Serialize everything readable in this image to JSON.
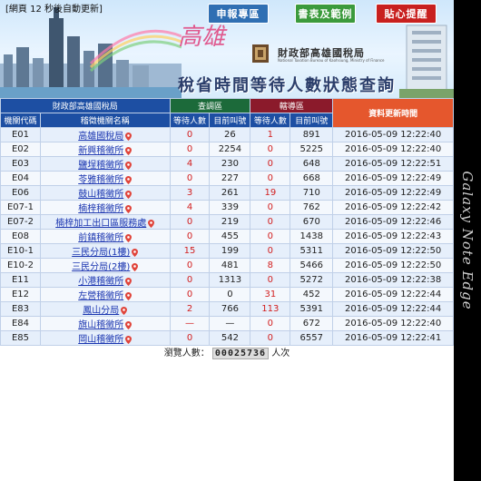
{
  "header": {
    "refresh_notice": "[網頁 12 秒後自動更新]",
    "nav": {
      "report": "申報專區",
      "forms": "書表及範例",
      "reminder": "貼心提醒"
    },
    "logo_art": "高雄",
    "bureau_name": "財政部高雄國稅局",
    "bureau_english": "National Taxation Bureau of Kaohsiung, Ministry of Finance",
    "page_title": "稅省時間等待人數狀態查詢"
  },
  "table": {
    "group_headers": {
      "left": "財政部高雄國稅局",
      "inquiry": "查調區",
      "transfer": "轄導區",
      "updated": "資料更新時間"
    },
    "columns": {
      "code": "機關代碼",
      "name": "稽徵機關名稱",
      "inquiry_waiting": "等待人數",
      "inquiry_current": "目前叫號",
      "transfer_waiting": "等待人數",
      "transfer_current": "目前叫號"
    },
    "rows": [
      {
        "code": "E01",
        "name": "高雄國稅局",
        "iw": "0",
        "ic": "26",
        "tw": "1",
        "tc": "891",
        "time": "2016-05-09 12:22:40"
      },
      {
        "code": "E02",
        "name": "新興稽徵所",
        "iw": "0",
        "ic": "2254",
        "tw": "0",
        "tc": "5225",
        "time": "2016-05-09 12:22:40"
      },
      {
        "code": "E03",
        "name": "鹽埕稽徵所",
        "iw": "4",
        "ic": "230",
        "tw": "0",
        "tc": "648",
        "time": "2016-05-09 12:22:51"
      },
      {
        "code": "E04",
        "name": "苓雅稽徵所",
        "iw": "0",
        "ic": "227",
        "tw": "0",
        "tc": "668",
        "time": "2016-05-09 12:22:49"
      },
      {
        "code": "E06",
        "name": "鼓山稽徵所",
        "iw": "3",
        "ic": "261",
        "tw": "19",
        "tc": "710",
        "time": "2016-05-09 12:22:49"
      },
      {
        "code": "E07-1",
        "name": "楠梓稽徵所",
        "iw": "4",
        "ic": "339",
        "tw": "0",
        "tc": "762",
        "time": "2016-05-09 12:22:42"
      },
      {
        "code": "E07-2",
        "name": "楠梓加工出口區服務處",
        "iw": "0",
        "ic": "219",
        "tw": "0",
        "tc": "670",
        "time": "2016-05-09 12:22:46"
      },
      {
        "code": "E08",
        "name": "前鎮稽徵所",
        "iw": "0",
        "ic": "455",
        "tw": "0",
        "tc": "1438",
        "time": "2016-05-09 12:22:43"
      },
      {
        "code": "E10-1",
        "name": "三民分局(1樓)",
        "iw": "15",
        "ic": "199",
        "tw": "0",
        "tc": "5311",
        "time": "2016-05-09 12:22:50"
      },
      {
        "code": "E10-2",
        "name": "三民分局(2樓)",
        "iw": "0",
        "ic": "481",
        "tw": "8",
        "tc": "5466",
        "time": "2016-05-09 12:22:50"
      },
      {
        "code": "E11",
        "name": "小港稽徵所",
        "iw": "0",
        "ic": "1313",
        "tw": "0",
        "tc": "5272",
        "time": "2016-05-09 12:22:38"
      },
      {
        "code": "E12",
        "name": "左營稽徵所",
        "iw": "0",
        "ic": "0",
        "tw": "31",
        "tc": "452",
        "time": "2016-05-09 12:22:44"
      },
      {
        "code": "E83",
        "name": "鳳山分局",
        "iw": "2",
        "ic": "766",
        "tw": "113",
        "tc": "5391",
        "time": "2016-05-09 12:22:44"
      },
      {
        "code": "E84",
        "name": "旗山稽徵所",
        "iw": "—",
        "ic": "—",
        "tw": "0",
        "tc": "672",
        "time": "2016-05-09 12:22:40"
      },
      {
        "code": "E85",
        "name": "岡山稽徵所",
        "iw": "0",
        "ic": "542",
        "tw": "0",
        "tc": "6557",
        "time": "2016-05-09 12:22:41"
      }
    ]
  },
  "footer": {
    "visitor_label": "瀏覽人數：",
    "visitor_count": "00025736",
    "visitor_unit": "人次"
  },
  "device_label": "Galaxy Note Edge",
  "colors": {
    "header_blue": "#1d4fa3",
    "inquiry_green": "#1c6a3a",
    "transfer_red": "#8b1a2b",
    "updated_orange": "#e5572d",
    "waiting_red": "#d21f1f",
    "link_blue": "#1a35b0"
  }
}
